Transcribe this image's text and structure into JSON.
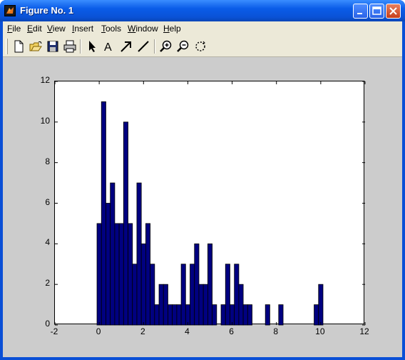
{
  "window": {
    "title": "Figure No. 1"
  },
  "menu": {
    "items": [
      {
        "label_u": "F",
        "label_rest": "ile"
      },
      {
        "label_u": "E",
        "label_rest": "dit"
      },
      {
        "label_u": "V",
        "label_rest": "iew"
      },
      {
        "label_u": "I",
        "label_rest": "nsert"
      },
      {
        "label_u": "T",
        "label_rest": "ools"
      },
      {
        "label_u": "W",
        "label_rest": "indow"
      },
      {
        "label_u": "H",
        "label_rest": "elp"
      }
    ]
  },
  "colors": {
    "bar_fill": "#000080",
    "bar_edge": "#000000",
    "figure_bg": "#cccccc",
    "title_bar": "#0a52d6"
  },
  "chart_data": {
    "type": "bar",
    "title": "",
    "xlabel": "",
    "ylabel": "",
    "xlim": [
      -2,
      12
    ],
    "ylim": [
      0,
      12
    ],
    "xticks": [
      "-2",
      "0",
      "2",
      "4",
      "6",
      "8",
      "10",
      "12"
    ],
    "yticks": [
      "0",
      "2",
      "4",
      "6",
      "8",
      "10",
      "12"
    ],
    "grid": false,
    "bin_width": 0.2,
    "bin_centers": [
      0.0,
      0.2,
      0.4,
      0.6,
      0.8,
      1.0,
      1.2,
      1.4,
      1.6,
      1.8,
      2.0,
      2.2,
      2.4,
      2.6,
      2.8,
      3.0,
      3.2,
      3.4,
      3.6,
      3.8,
      4.0,
      4.2,
      4.4,
      4.6,
      4.8,
      5.0,
      5.2,
      5.4,
      5.6,
      5.8,
      6.0,
      6.2,
      6.4,
      6.6,
      6.8,
      7.0,
      7.2,
      7.4,
      7.6,
      7.8,
      8.0,
      8.2,
      8.4,
      8.6,
      8.8,
      9.0,
      9.2,
      9.4,
      9.6,
      9.8,
      10.0
    ],
    "values": [
      5,
      11,
      6,
      7,
      5,
      5,
      10,
      5,
      3,
      7,
      4,
      5,
      3,
      1,
      2,
      2,
      1,
      1,
      1,
      3,
      1,
      3,
      4,
      2,
      2,
      4,
      1,
      0,
      1,
      3,
      1,
      3,
      2,
      1,
      1,
      0,
      0,
      0,
      1,
      0,
      0,
      1,
      0,
      0,
      0,
      0,
      0,
      0,
      0,
      1,
      2
    ]
  }
}
